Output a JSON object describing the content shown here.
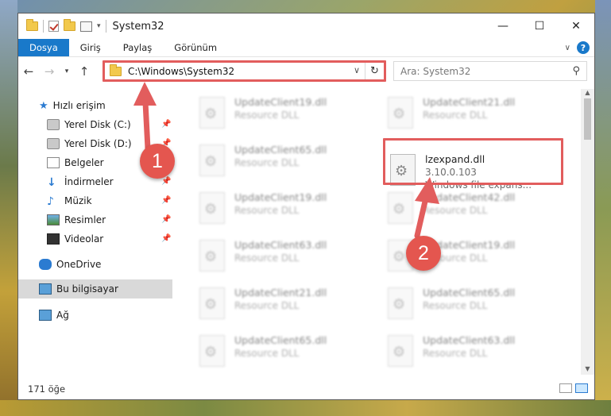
{
  "window": {
    "title": "System32",
    "controls": {
      "minimize": "—",
      "maximize": "☐",
      "close": "✕"
    }
  },
  "ribbon": {
    "tabs": [
      "Dosya",
      "Giriş",
      "Paylaş",
      "Görünüm"
    ],
    "help": "?"
  },
  "address": {
    "path": "C:\\Windows\\System32",
    "search_placeholder": "Ara: System32"
  },
  "sidebar": {
    "quick_access": "Hızlı erişim",
    "items": [
      "Yerel Disk (C:)",
      "Yerel Disk (D:)",
      "Belgeler",
      "İndirmeler",
      "Müzik",
      "Resimler",
      "Videolar"
    ],
    "onedrive": "OneDrive",
    "this_pc": "Bu bilgisayar",
    "network": "Ağ"
  },
  "files": {
    "left_column": [
      {
        "name": "UpdateClient19.dll",
        "type": "Resource DLL"
      },
      {
        "name": "UpdateClient65.dll",
        "type": "Resource DLL"
      },
      {
        "name": "UpdateClient19.dll",
        "type": "Resource DLL"
      },
      {
        "name": "UpdateClient63.dll",
        "type": "Resource DLL"
      },
      {
        "name": "UpdateClient21.dll",
        "type": "Resource DLL"
      },
      {
        "name": "UpdateClient65.dll",
        "type": "Resource DLL"
      }
    ],
    "right_column": [
      {
        "name": "UpdateClient21.dll",
        "type": "Resource DLL"
      },
      {
        "name": "UpdateClient42.dll",
        "type": "Resource DLL"
      },
      {
        "name": "UpdateClient19.dll",
        "type": "Resource DLL"
      },
      {
        "name": "UpdateClient65.dll",
        "type": "Resource DLL"
      },
      {
        "name": "UpdateClient63.dll",
        "type": "Resource DLL"
      }
    ],
    "highlighted": {
      "name": "lzexpand.dll",
      "version": "3.10.0.103",
      "description": "Windows file expans..."
    }
  },
  "status": {
    "count": "171 öğe"
  },
  "markers": [
    "1",
    "2"
  ],
  "colors": {
    "accent": "#1979ca",
    "annotation": "#e25d5d"
  }
}
